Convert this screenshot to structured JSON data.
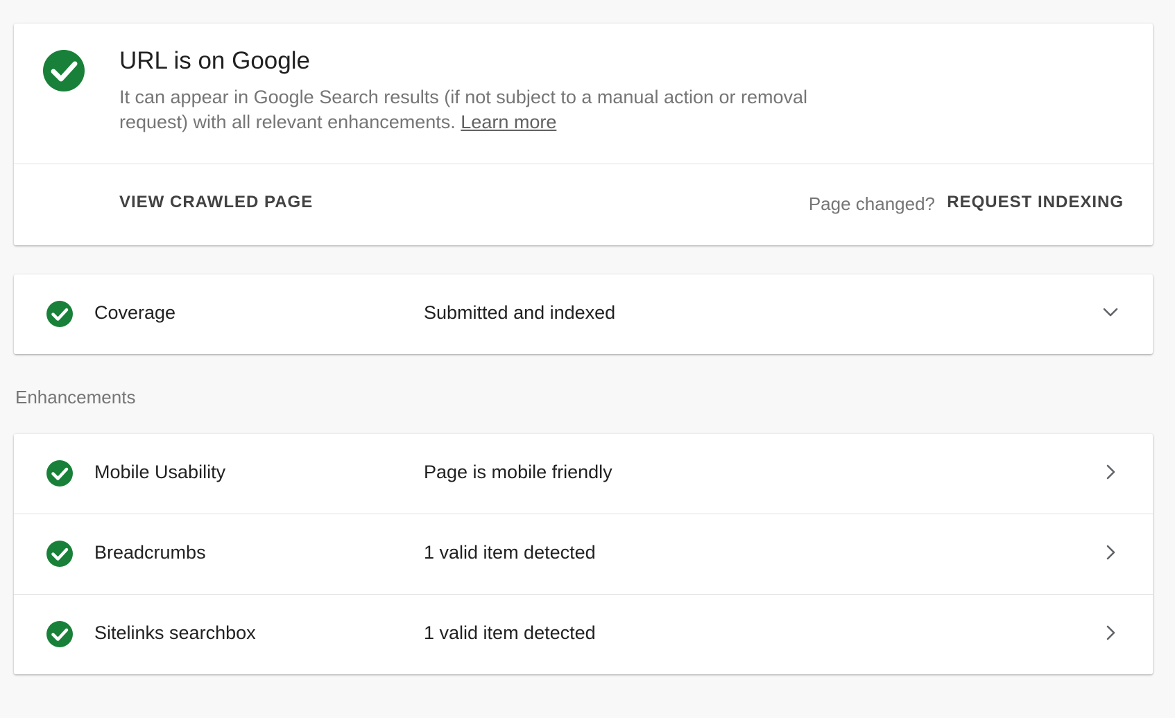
{
  "status": {
    "title": "URL is on Google",
    "description": "It can appear in Google Search results (if not subject to a manual action or removal request) with all relevant enhancements.",
    "learn_more": "Learn more",
    "view_crawled_label": "VIEW CRAWLED PAGE",
    "page_changed_label": "Page changed?",
    "request_indexing_label": "REQUEST INDEXING",
    "icon": "check-circle-icon",
    "accent_color": "#188038"
  },
  "coverage": {
    "label": "Coverage",
    "value": "Submitted and indexed",
    "icon": "check-circle-icon",
    "chevron": "chevron-down-icon"
  },
  "enhancements": {
    "heading": "Enhancements",
    "items": [
      {
        "label": "Mobile Usability",
        "value": "Page is mobile friendly",
        "icon": "check-circle-icon",
        "chevron": "chevron-right-icon"
      },
      {
        "label": "Breadcrumbs",
        "value": "1 valid item detected",
        "icon": "check-circle-icon",
        "chevron": "chevron-right-icon"
      },
      {
        "label": "Sitelinks searchbox",
        "value": "1 valid item detected",
        "icon": "check-circle-icon",
        "chevron": "chevron-right-icon"
      }
    ]
  }
}
